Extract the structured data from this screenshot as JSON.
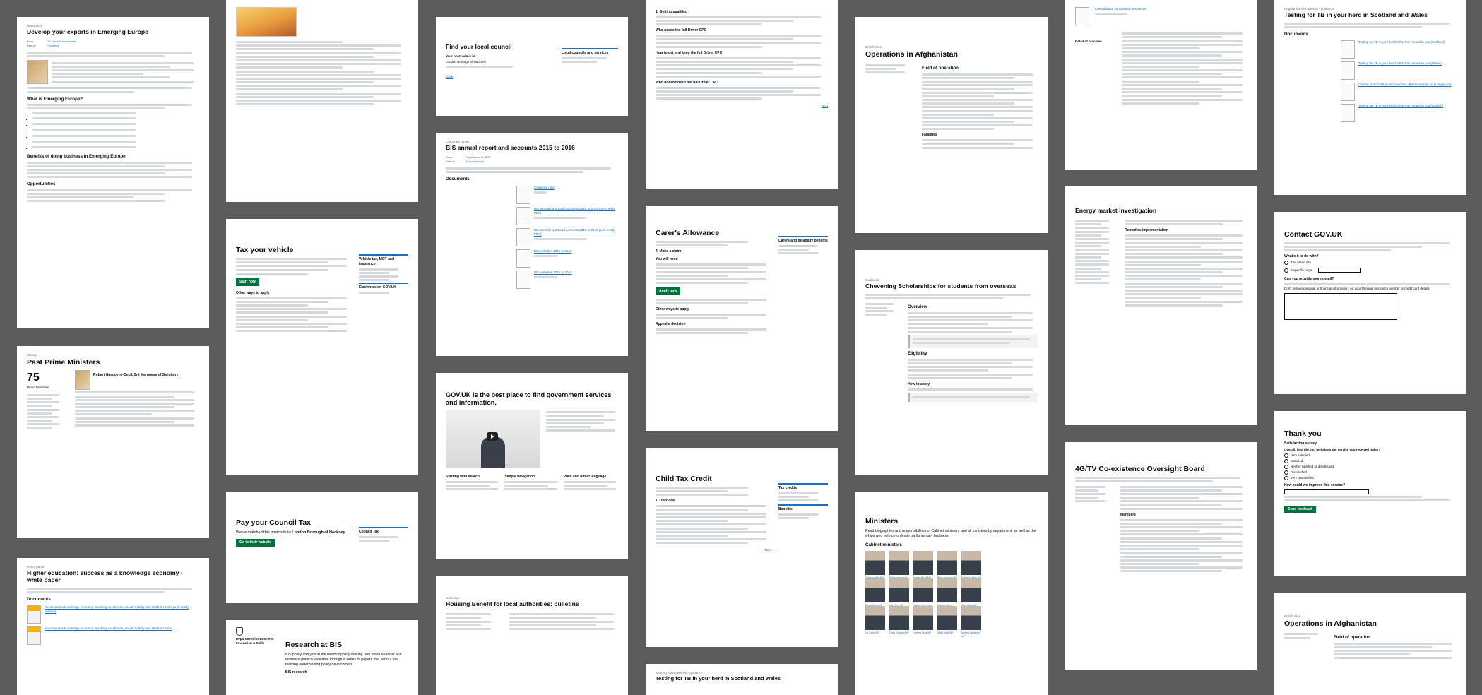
{
  "colors": {
    "background": "#5c5c5c",
    "link": "#1d70b8",
    "button": "#00703c"
  },
  "cards": {
    "emerging": {
      "kicker": "News story",
      "title": "Develop your exports in Emerging Europe",
      "h_what": "What is Emerging Europe?",
      "h_benefits": "Benefits of doing business in Emerging Europe",
      "h_opps": "Opportunities"
    },
    "pm": {
      "kicker": "History",
      "title": "Past Prime Ministers",
      "count": "75",
      "count_label": "Prime Ministers",
      "person": "Robert Gascoyne-Cecil, 3rd Marquess of Salisbury"
    },
    "higher_ed": {
      "kicker": "Policy paper",
      "title": "Higher education: success as a knowledge economy - white paper",
      "h_docs": "Documents",
      "doc1": "Success as a knowledge economy: teaching excellence, social mobility and student choice (web ready version)",
      "doc2": "Success as a knowledge economy: teaching excellence, social mobility and student choice"
    },
    "tax_vehicle": {
      "title": "Tax your vehicle",
      "start": "Start now",
      "h_other": "Other ways to apply",
      "side": "Vehicle tax, MOT and insurance",
      "side2": "Elsewhere on GOV.UK"
    },
    "council_tax": {
      "title": "Pay your Council Tax",
      "lead_prefix": "We've matched this postcode to",
      "lead_bold": "London Borough of Hackney",
      "go": "Go to their website",
      "side": "Council Tax"
    },
    "research_bis": {
      "dept": "Department for Business Innovation & Skills",
      "title": "Research at BIS",
      "lead": "BIS policy analysis at the heart of policy making. We make analysis and evidence publicly available through a series of papers that set out the thinking underpinning policy development.",
      "h2": "BIS research"
    },
    "local_council": {
      "title": "Find your local council",
      "lead": "Your postcode is in:",
      "council": "London Borough of Hackney",
      "side": "Local councils and services",
      "back": "Back"
    },
    "bis_annual": {
      "kicker": "Corporate report",
      "title": "BIS annual report and accounts 2015 to 2016",
      "h_docs": "Documents",
      "d1": "Correction slip",
      "d2": "BIS annual report and accounts 2015 to 2016 (print ready PDF)",
      "d3": "BIS annual report and accounts 2015 to 2016 (web ready PDF)",
      "d4": "BIS websites 2015 to 2016",
      "d5": "BIS websites 2015 to 2016"
    },
    "govuk": {
      "title": "GOV.UK is the best place to find government services and information.",
      "f1": "Starting with search",
      "f2": "Simple navigation",
      "f3": "Plain and direct language"
    },
    "housing": {
      "kicker": "Collection",
      "title": "Housing Benefit for local authorities: bulletins"
    },
    "cpc": {
      "h1": "1. Getting qualified",
      "h2": "Who needs the full Driver CPC",
      "h3": "How to get and keep the full Driver CPC",
      "h4": "Who doesn't need the full Driver CPC",
      "next": "Next"
    },
    "carers": {
      "title": "Carer's Allowance",
      "h_apply": "4. Make a claim",
      "h_need": "You will need",
      "apply": "Apply now",
      "h_other": "Other ways to apply",
      "h_appeal": "Appeal a decision",
      "side": "Carers and disability benefits"
    },
    "child_tax": {
      "title": "Child Tax Credit",
      "h_overview": "1. Overview",
      "side": "Tax credits",
      "side2": "Benefits",
      "next": "Next"
    },
    "testing_bottom": {
      "kicker": "Nearing formal entries - guidance",
      "title": "Testing for TB in your herd in Scotland and Wales"
    },
    "afghan": {
      "kicker": "British Isles",
      "title": "Operations in Afghanistan",
      "h_field": "Field of operation",
      "h_fatal": "Fatalities"
    },
    "chevening": {
      "kicker": "Guidance",
      "title": "Chevening Scholarships for students from overseas",
      "h_overview": "Overview",
      "h_elig": "Eligibility",
      "h_apply": "How to apply"
    },
    "ministers": {
      "title": "Ministers",
      "lead": "Read biographies and responsibilities of Cabinet ministers and all ministers by department, as well as the whips who help co-ordinate parliamentary business.",
      "h_cabinet": "Cabinet ministers",
      "names": [
        "Theresa May MP",
        "Philip Hammond MP",
        "Amber Rudd MP",
        "Boris Johnson MP",
        "Michael Fallon MP",
        "David Davis MP",
        "Liam Fox MP",
        "Justine Greening MP",
        "Damian Green MP",
        "Greg Clark MP",
        "Liz Truss MP",
        "Chris Grayling MP",
        "Jeremy Hunt MP",
        "Sajid Javid MP",
        "Andrea Leadsom MP"
      ]
    },
    "consultation": {
      "label": "Detail of outcome",
      "link": "Consolidated consultation responses"
    },
    "energy": {
      "title": "Energy market investigation",
      "h_remedies": "Remedies implementation"
    },
    "tv": {
      "title": "4G/TV Co-existence Oversight Board",
      "h_members": "Members"
    },
    "testing_top": {
      "kicker": "Regular farmed animals - guidance",
      "title": "Testing for TB in your herd in Scotland and Wales",
      "h_docs": "Documents",
      "d1": "Testing for TB in your herd: what this means to you (Scotland)",
      "d2": "Testing for TB in your herd: what this means to you (Wales)",
      "d3": "Camau profion TB yn eich buches - Beth mae hyn yn ei olygu i chi",
      "d4": "Testing for TB in your herd: what this means to you (English)"
    },
    "contact": {
      "title": "Contact GOV.UK",
      "q1": "What's it to do with?",
      "o1": "The whole site",
      "o2": "A specific page",
      "q2": "Can you provide more detail?",
      "q3": "Don't include personal or financial information, eg your National Insurance number or credit card details."
    },
    "thanks": {
      "title": "Thank you",
      "h": "Satisfaction survey",
      "q": "Overall, how did you feel about the service you received today?",
      "opts": [
        "Very satisfied",
        "Satisfied",
        "Neither satisfied or dissatisfied",
        "Dissatisfied",
        "Very dissatisfied"
      ],
      "q2": "How could we improve this service?",
      "send": "Send feedback"
    },
    "afghan2": {
      "kicker": "British Isles",
      "title": "Operations in Afghanistan",
      "h_field": "Field of operation"
    }
  }
}
